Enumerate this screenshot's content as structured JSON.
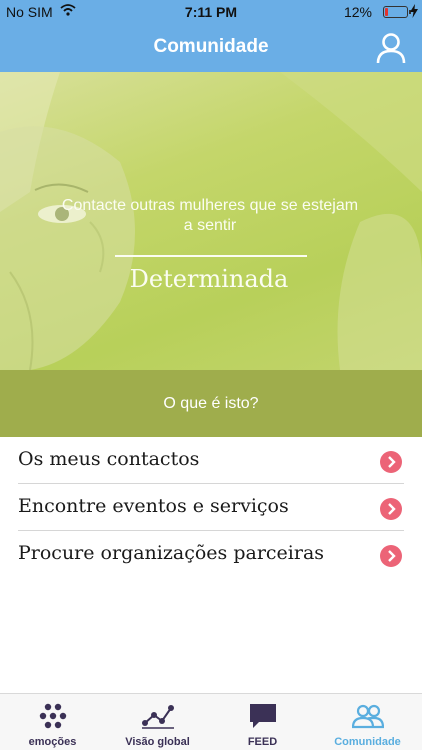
{
  "status_bar": {
    "carrier": "No SIM",
    "time": "7:11 PM",
    "battery_percent": "12%",
    "battery_level": 0.12,
    "battery_color": "#e2342f"
  },
  "header": {
    "title": "Comunidade",
    "profile_icon": "profile-icon",
    "background_color": "#6aaee6"
  },
  "hero": {
    "lead_text": "Contacte outras mulheres que se estejam a sentir",
    "emotion": "Determinada",
    "background_color": "#c4d66a"
  },
  "info_button": {
    "label": "O que é isto?",
    "background_color": "#9fad4c"
  },
  "menu": {
    "items": [
      {
        "label": "Os meus contactos",
        "icon": "chevron-right-icon"
      },
      {
        "label": "Encontre eventos e serviços",
        "icon": "chevron-right-icon"
      },
      {
        "label": "Procure organizações parceiras",
        "icon": "chevron-right-icon"
      }
    ],
    "accent_color": "#ec6477"
  },
  "tab_bar": {
    "tabs": [
      {
        "label": "emoções",
        "icon": "emotions-dots-icon",
        "active": false
      },
      {
        "label": "Visão global",
        "icon": "graph-icon",
        "active": false
      },
      {
        "label": "FEED",
        "icon": "chat-bubble-icon",
        "active": false
      },
      {
        "label": "Comunidade",
        "icon": "people-icon",
        "active": true
      }
    ],
    "active_color": "#5aaedf",
    "inactive_color": "#3b3156"
  }
}
